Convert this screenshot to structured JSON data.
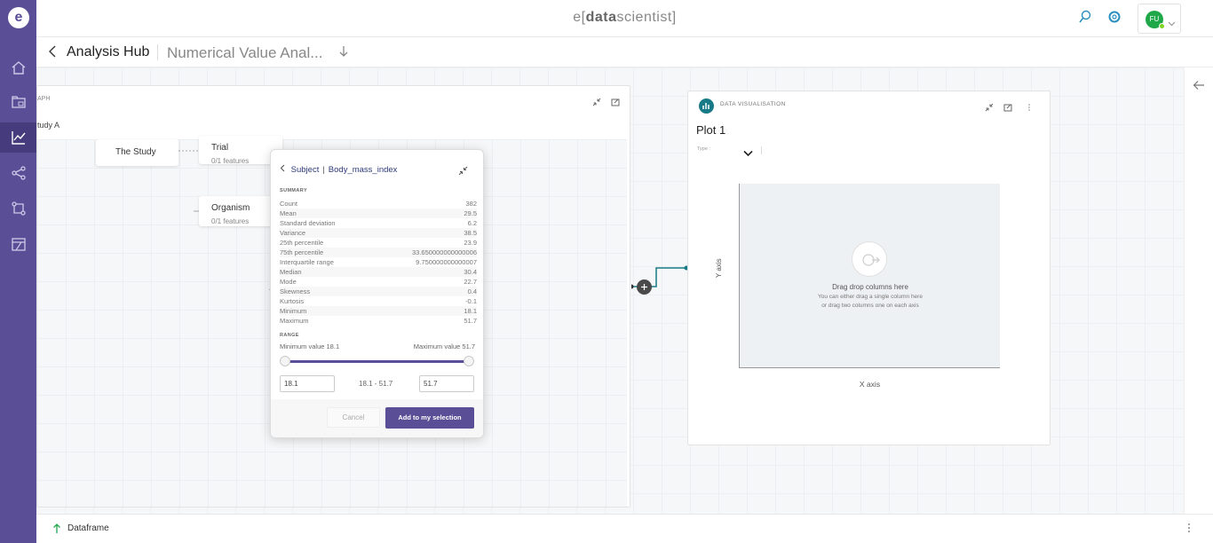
{
  "app": {
    "brand_prefix": "e[",
    "brand_bold": "data",
    "brand_rest": "scientist]"
  },
  "user": {
    "initials": "FU"
  },
  "breadcrumb": {
    "hub": "Analysis Hub",
    "page": "Numerical Value Anal..."
  },
  "graph_panel": {
    "label": "APH",
    "subtitle": "tudy A",
    "nodes": [
      {
        "title": "The Study",
        "features": ""
      },
      {
        "title": "Trial",
        "features": "0/1 features"
      },
      {
        "title": "Organism",
        "features": "0/1 features"
      }
    ]
  },
  "summary_popup": {
    "entity": "Subject",
    "column": "Body_mass_index",
    "summary_heading": "SUMMARY",
    "stats": [
      {
        "label": "Count",
        "value": "382"
      },
      {
        "label": "Mean",
        "value": "29.5"
      },
      {
        "label": "Standard deviation",
        "value": "6.2"
      },
      {
        "label": "Variance",
        "value": "38.5"
      },
      {
        "label": "25th percentile",
        "value": "23.9"
      },
      {
        "label": "75th percentile",
        "value": "33.650000000000006"
      },
      {
        "label": "Interquartile range",
        "value": "9.750000000000007"
      },
      {
        "label": "Median",
        "value": "30.4"
      },
      {
        "label": "Mode",
        "value": "22.7"
      },
      {
        "label": "Skewness",
        "value": "0.4"
      },
      {
        "label": "Kurtosis",
        "value": "-0.1"
      },
      {
        "label": "Minimum",
        "value": "18.1"
      },
      {
        "label": "Maximum",
        "value": "51.7"
      }
    ],
    "range_heading": "RANGE",
    "min_label": "Minimum value 18.1",
    "max_label": "Maximum value 51.7",
    "min_input": "18.1",
    "max_input": "51.7",
    "range_text": "18.1 - 51.7",
    "cancel_label": "Cancel",
    "add_label": "Add to my selection"
  },
  "viz_panel": {
    "label": "DATA VISUALISATION",
    "title": "Plot 1",
    "type_label": "Type :",
    "drop_title": "Drag drop columns here",
    "drop_hint_1": "You can either drag a single column here",
    "drop_hint_2": "or drag two columns one on each axis",
    "y_axis": "Y axis",
    "x_axis": "X axis"
  },
  "bottom_bar": {
    "label": "Dataframe"
  },
  "colors": {
    "sidebar": "#5a4e96",
    "accent": "#5a4e96",
    "teal": "#177a86",
    "link": "#2a8fbf"
  }
}
